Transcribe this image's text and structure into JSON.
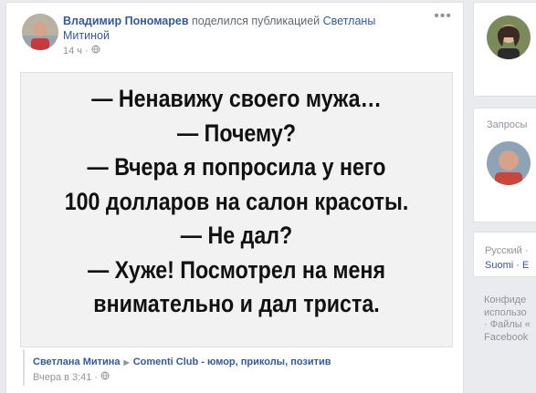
{
  "post": {
    "author": "Владимир Пономарев",
    "action": "поделился публикацией",
    "shared_author": "Светланы Митиной",
    "time": "14 ч",
    "sep": "·",
    "more": "•••",
    "joke_lines": [
      "— Ненавижу своего мужа…",
      "— Почему?",
      "— Вчера я попросила у него",
      "100 долларов на салон красоты.",
      "— Не дал?",
      "— Хуже! Посмотрел на меня",
      "внимательно и дал триста."
    ],
    "source_author": "Светлана Митина",
    "source_arrow": "▶",
    "source_page": "Comenti Club - юмор, приколы, позитив",
    "source_time": "Вчера в 3:41",
    "source_sep": "·"
  },
  "sidebar": {
    "requests_title": "Запросы",
    "languages": [
      "Русский ·",
      "Suomi · E"
    ],
    "footer_lines": [
      "Конфиде",
      "использо",
      "· Файлы «",
      "Facebook"
    ]
  },
  "colors": {
    "link": "#385898",
    "meta": "#90949c",
    "bg": "#e9ebee"
  },
  "icons": {
    "globe": "globe-icon",
    "more": "more-icon"
  }
}
